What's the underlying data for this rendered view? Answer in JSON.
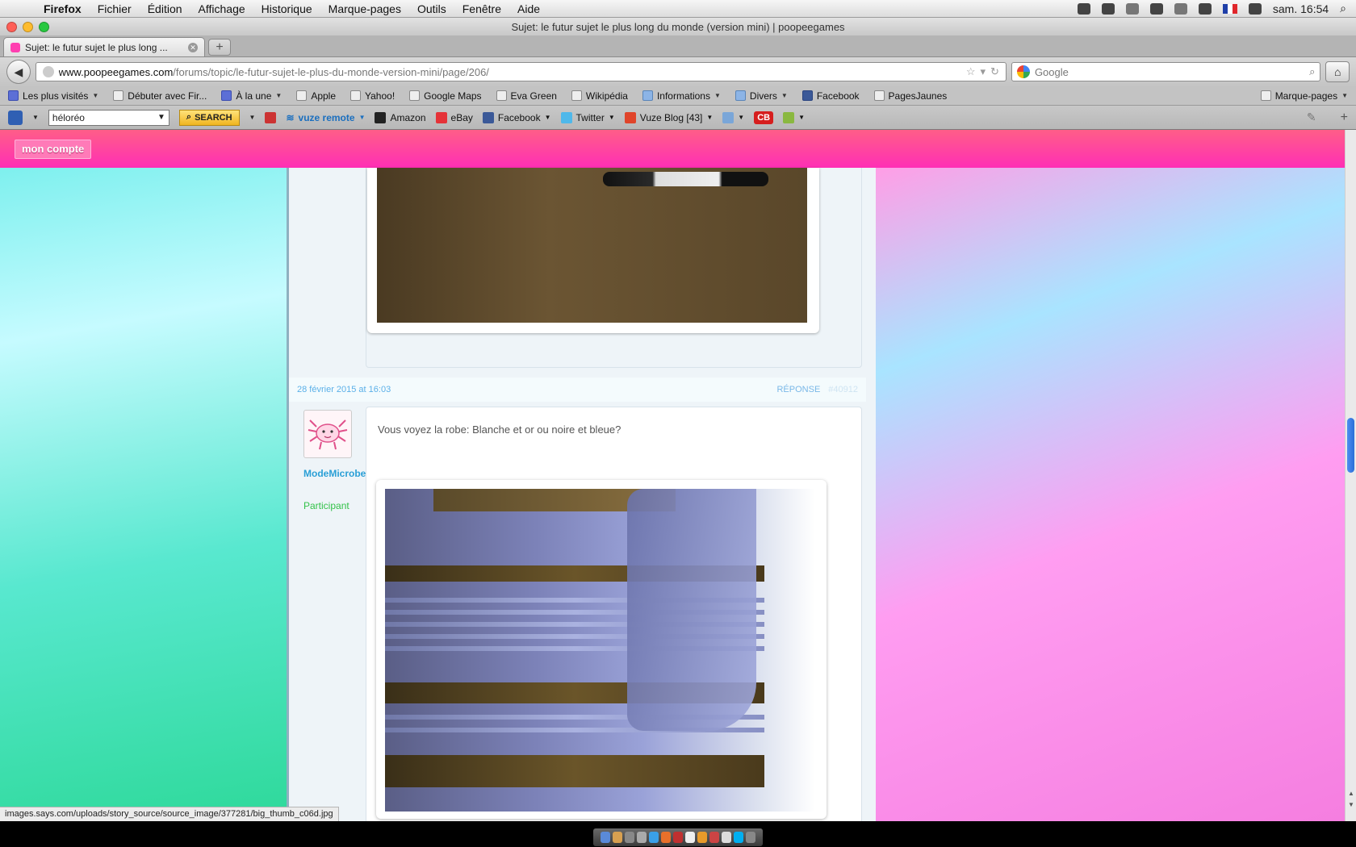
{
  "menubar": {
    "app": "Firefox",
    "items": [
      "Fichier",
      "Édition",
      "Affichage",
      "Historique",
      "Marque-pages",
      "Outils",
      "Fenêtre",
      "Aide"
    ],
    "clock": "sam. 16:54"
  },
  "window": {
    "title": "Sujet: le futur sujet le plus long du monde (version mini) | poopeegames"
  },
  "tabs": [
    {
      "label": "Sujet: le futur sujet le plus long ..."
    }
  ],
  "navbar": {
    "url_domain": "www.poopeegames.com",
    "url_path": "/forums/topic/le-futur-sujet-le-plus-du-monde-version-mini/page/206/",
    "search_placeholder": "Google"
  },
  "bookmarks": {
    "items": [
      {
        "label": "Les plus visités",
        "icon": "most-visited-icon",
        "dropdown": true
      },
      {
        "label": "Débuter avec Fir...",
        "icon": "page-icon"
      },
      {
        "label": "À la une",
        "icon": "rss-icon",
        "dropdown": true
      },
      {
        "label": "Apple",
        "icon": "page-icon"
      },
      {
        "label": "Yahoo!",
        "icon": "page-icon"
      },
      {
        "label": "Google Maps",
        "icon": "page-icon"
      },
      {
        "label": "Eva Green",
        "icon": "page-icon"
      },
      {
        "label": "Wikipédia",
        "icon": "page-icon"
      },
      {
        "label": "Informations",
        "icon": "folder-icon",
        "dropdown": true
      },
      {
        "label": "Divers",
        "icon": "folder-icon",
        "dropdown": true
      },
      {
        "label": "Facebook",
        "icon": "facebook-icon"
      },
      {
        "label": "PagesJaunes",
        "icon": "page-icon"
      }
    ],
    "right_label": "Marque-pages"
  },
  "addonbar": {
    "search_value": "héloréo",
    "search_button": "SEARCH",
    "vuze_label": "vuze remote",
    "items": [
      "Amazon",
      "eBay",
      "Facebook",
      "Twitter",
      "Vuze Blog [43]"
    ],
    "cb_label": "CB"
  },
  "page": {
    "account_button": "mon compte",
    "post_date": "28 février 2015 at 16:03",
    "reply_label": "RÉPONSE",
    "post_number": "#40912",
    "author_name": "ModeMicrobe",
    "author_role": "Participant",
    "post_text": "Vous voyez la robe: Blanche et or ou noire et bleue?"
  },
  "statusbar": {
    "text": "images.says.com/uploads/story_source/source_image/377281/big_thumb_c06d.jpg"
  },
  "colors": {
    "header_pink": "#ff2fb5",
    "author_blue": "#2a9fd6",
    "role_green": "#33c24a",
    "link_blue": "#5bb0e8"
  }
}
